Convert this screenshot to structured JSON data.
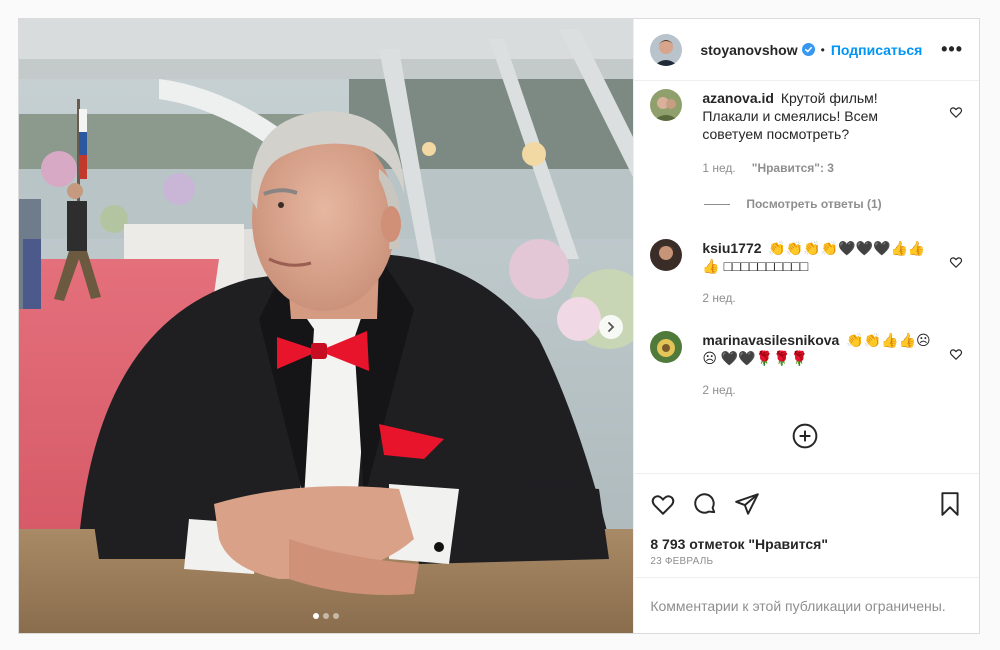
{
  "post": {
    "author": "stoyanovshow",
    "separator": "•",
    "follow_label": "Подписаться",
    "more_label": "•••",
    "carousel": {
      "count": 3,
      "active": 0
    }
  },
  "comments": [
    {
      "username": "azanova.id",
      "text": "Крутой фильм! Плакали и смеялись! Всем советуем посмотреть?",
      "time": "1 нед.",
      "likes": "\"Нравится\": 3",
      "view_replies": "Посмотреть ответы (1)"
    },
    {
      "username": "ksiu1772",
      "text": "👏👏👏👏🖤🖤🖤👍👍👍 □□□□□□□□□□",
      "time": "2 нед."
    },
    {
      "username": "marinavasilesnikova",
      "text": "👏👏👍👍☹☹ 🖤🖤🌹🌹🌹",
      "time": "2 нед."
    }
  ],
  "footer": {
    "likes_text": "8 793 отметок \"Нравится\"",
    "date_text": "23 ФЕВРАЛЬ",
    "restricted_text": "Комментарии к этой публикации ограничены."
  },
  "colors": {
    "accent": "#0095f6",
    "muted": "#8e8e8e",
    "text": "#262626",
    "border": "#dbdbdb"
  },
  "icons": [
    "verified-badge-icon",
    "heart-icon",
    "comment-icon",
    "share-icon",
    "bookmark-icon",
    "plus-circle-icon",
    "chevron-right-icon",
    "more-icon"
  ]
}
